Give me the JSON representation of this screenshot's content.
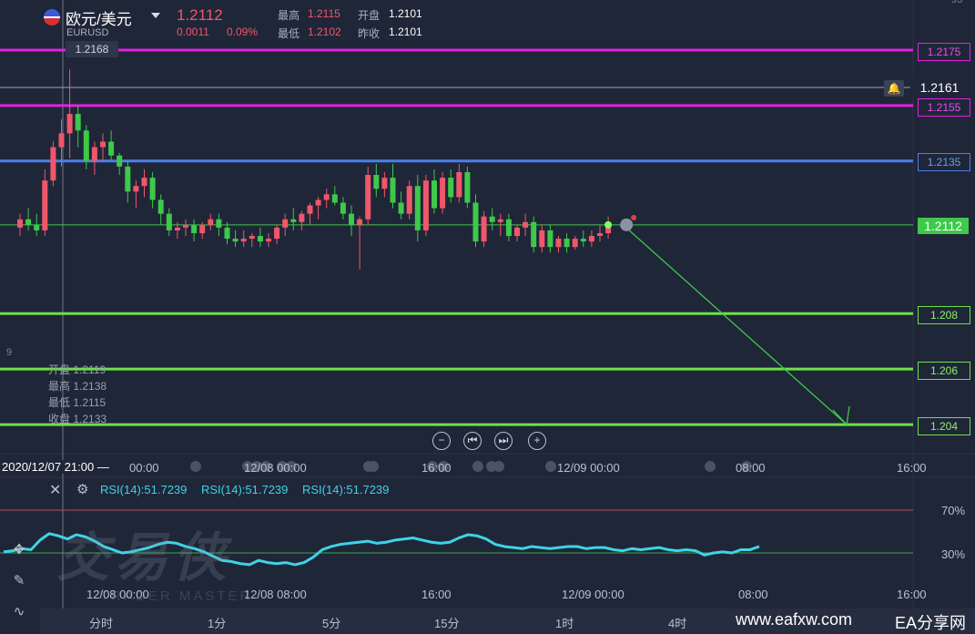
{
  "header": {
    "symbol": "欧元/美元",
    "sub_symbol": "EURUSD",
    "price": "1.2112",
    "change": "0.0011",
    "change_pct": "0.09%",
    "high_label": "最高",
    "high_value": "1.2115",
    "open_label": "开盘",
    "open_value": "1.2101",
    "low_label": "最低",
    "low_value": "1.2102",
    "prev_close_label": "昨收",
    "prev_close_value": "1.2101"
  },
  "crosshair": {
    "price_tag": "1.2168",
    "time_tag": "2020/12/07 21:00 —",
    "ohlc": [
      {
        "label": "开盘",
        "value": "1.2119"
      },
      {
        "label": "最高",
        "value": "1.2138"
      },
      {
        "label": "最低",
        "value": "1.2115"
      },
      {
        "label": "收盘",
        "value": "1.2133"
      }
    ],
    "side_digit": "9"
  },
  "price_levels": [
    {
      "value": "1.2175",
      "color": "#e020e0"
    },
    {
      "value": "1.2161",
      "color": "#a0a6b4"
    },
    {
      "value": "1.2155",
      "color": "#e020e0"
    },
    {
      "value": "1.2135",
      "color": "#4a7fe8"
    },
    {
      "value": "1.2112",
      "color": "#3ec94a"
    },
    {
      "value": "1.208",
      "color": "#6fe04a"
    },
    {
      "value": "1.206",
      "color": "#6fe04a"
    },
    {
      "value": "1.204",
      "color": "#6fe04a"
    }
  ],
  "top_right_partial": "93",
  "time_axis": [
    "00:00",
    "12/08 00:00",
    "16:00",
    "12/09 00:00",
    "08:00",
    "16:00"
  ],
  "rsi": {
    "labels": [
      "RSI(14):51.7239",
      "RSI(14):51.7239",
      "RSI(14):51.7239"
    ],
    "level_high": "70%",
    "level_low": "30%",
    "time_axis": [
      "12/08 00:00",
      "12/08 08:00",
      "16:00",
      "12/09 00:00",
      "08:00",
      "16:00"
    ]
  },
  "periods": [
    "分时",
    "1分",
    "5分",
    "15分",
    "1时",
    "4时"
  ],
  "watermark": {
    "cn": "交易侠",
    "en": "TRADER MASTER"
  },
  "footer": {
    "site": "www.eafxw.com",
    "brand": "EA分享网"
  },
  "colors": {
    "up": "#f0576a",
    "down": "#3ec94a",
    "rsi": "#3dd4e6",
    "bg": "#1f2638"
  },
  "chart_data": {
    "type": "candlestick",
    "candles": [
      [
        1.2111,
        1.2116,
        1.2108,
        1.2114
      ],
      [
        1.2114,
        1.2118,
        1.211,
        1.2112
      ],
      [
        1.2112,
        1.2116,
        1.2108,
        1.211
      ],
      [
        1.211,
        1.2132,
        1.2108,
        1.2128
      ],
      [
        1.2128,
        1.2142,
        1.2126,
        1.214
      ],
      [
        1.214,
        1.215,
        1.2133,
        1.2145
      ],
      [
        1.2145,
        1.2168,
        1.2136,
        1.2152
      ],
      [
        1.2152,
        1.2155,
        1.214,
        1.2146
      ],
      [
        1.2146,
        1.2148,
        1.2132,
        1.2135
      ],
      [
        1.2135,
        1.2142,
        1.213,
        1.214
      ],
      [
        1.214,
        1.2145,
        1.2135,
        1.2142
      ],
      [
        1.2142,
        1.2146,
        1.2135,
        1.2137
      ],
      [
        1.2137,
        1.2138,
        1.213,
        1.2133
      ],
      [
        1.2133,
        1.2135,
        1.212,
        1.2124
      ],
      [
        1.2124,
        1.2128,
        1.2118,
        1.2126
      ],
      [
        1.2126,
        1.2132,
        1.2122,
        1.2129
      ],
      [
        1.2129,
        1.2131,
        1.2118,
        1.2121
      ],
      [
        1.2121,
        1.2123,
        1.2112,
        1.2116
      ],
      [
        1.2116,
        1.2118,
        1.2108,
        1.211
      ],
      [
        1.211,
        1.2113,
        1.2107,
        1.2111
      ],
      [
        1.2111,
        1.2114,
        1.2108,
        1.2112
      ],
      [
        1.2112,
        1.2114,
        1.2106,
        1.2109
      ],
      [
        1.2109,
        1.2113,
        1.2107,
        1.2112
      ],
      [
        1.2112,
        1.2116,
        1.211,
        1.2114
      ],
      [
        1.2114,
        1.2116,
        1.2108,
        1.2111
      ],
      [
        1.2111,
        1.2113,
        1.2105,
        1.2107
      ],
      [
        1.2107,
        1.211,
        1.2104,
        1.2106
      ],
      [
        1.2106,
        1.211,
        1.2104,
        1.2107
      ],
      [
        1.2107,
        1.2109,
        1.2104,
        1.2108
      ],
      [
        1.2108,
        1.2111,
        1.2104,
        1.2106
      ],
      [
        1.2106,
        1.2109,
        1.2104,
        1.2107
      ],
      [
        1.2107,
        1.2112,
        1.2105,
        1.2111
      ],
      [
        1.2111,
        1.2116,
        1.2108,
        1.2114
      ],
      [
        1.2114,
        1.2118,
        1.211,
        1.2113
      ],
      [
        1.2113,
        1.2117,
        1.211,
        1.2116
      ],
      [
        1.2116,
        1.212,
        1.2112,
        1.2119
      ],
      [
        1.2119,
        1.2122,
        1.2114,
        1.2121
      ],
      [
        1.2121,
        1.2125,
        1.2118,
        1.2123
      ],
      [
        1.2123,
        1.2126,
        1.2119,
        1.212
      ],
      [
        1.212,
        1.2122,
        1.2114,
        1.2116
      ],
      [
        1.2116,
        1.2119,
        1.2108,
        1.2112
      ],
      [
        1.2112,
        1.2115,
        1.2096,
        1.2114
      ],
      [
        1.2114,
        1.2133,
        1.2112,
        1.213
      ],
      [
        1.213,
        1.2134,
        1.2122,
        1.2125
      ],
      [
        1.2125,
        1.2131,
        1.2122,
        1.2129
      ],
      [
        1.2129,
        1.2134,
        1.2118,
        1.212
      ],
      [
        1.212,
        1.2124,
        1.2114,
        1.2116
      ],
      [
        1.2116,
        1.2128,
        1.2114,
        1.2126
      ],
      [
        1.2126,
        1.213,
        1.2106,
        1.211
      ],
      [
        1.211,
        1.213,
        1.2108,
        1.2128
      ],
      [
        1.2128,
        1.2132,
        1.2116,
        1.2118
      ],
      [
        1.2118,
        1.2131,
        1.2116,
        1.2129
      ],
      [
        1.2129,
        1.2132,
        1.212,
        1.2122
      ],
      [
        1.2122,
        1.2134,
        1.212,
        1.2131
      ],
      [
        1.2131,
        1.2133,
        1.2118,
        1.212
      ],
      [
        1.212,
        1.2123,
        1.2104,
        1.2106
      ],
      [
        1.2106,
        1.2117,
        1.2104,
        1.2115
      ],
      [
        1.2115,
        1.2118,
        1.211,
        1.2113
      ],
      [
        1.2113,
        1.2116,
        1.2108,
        1.2114
      ],
      [
        1.2114,
        1.2116,
        1.2106,
        1.2108
      ],
      [
        1.2108,
        1.2112,
        1.2106,
        1.2111
      ],
      [
        1.2111,
        1.2116,
        1.2108,
        1.2113
      ],
      [
        1.2113,
        1.2115,
        1.2102,
        1.2104
      ],
      [
        1.2104,
        1.2112,
        1.2102,
        1.211
      ],
      [
        1.211,
        1.2112,
        1.2102,
        1.2104
      ],
      [
        1.2104,
        1.2108,
        1.2102,
        1.2107
      ],
      [
        1.2107,
        1.2109,
        1.2102,
        1.2104
      ],
      [
        1.2104,
        1.2108,
        1.2103,
        1.2107
      ],
      [
        1.2107,
        1.211,
        1.2104,
        1.2106
      ],
      [
        1.2106,
        1.211,
        1.2104,
        1.2108
      ],
      [
        1.2108,
        1.2112,
        1.2106,
        1.2109
      ],
      [
        1.2109,
        1.2115,
        1.2107,
        1.2112
      ]
    ],
    "forecast_target": 1.204,
    "rsi_values": [
      31,
      32,
      34,
      33,
      42,
      48,
      46,
      43,
      47,
      45,
      41,
      36,
      33,
      30,
      31,
      33,
      35,
      38,
      40,
      39,
      36,
      34,
      31,
      27,
      23,
      22,
      20,
      19,
      23,
      21,
      20,
      21,
      19,
      21,
      26,
      33,
      36,
      38,
      39,
      40,
      41,
      39,
      40,
      42,
      43,
      44,
      42,
      40,
      39,
      40,
      44,
      47,
      46,
      43,
      38,
      36,
      35,
      34,
      36,
      35,
      34,
      35,
      36,
      36,
      34,
      35,
      35,
      33,
      32,
      34,
      33,
      34,
      35,
      33,
      32,
      33,
      32,
      28,
      30,
      31,
      30,
      33,
      33,
      36
    ]
  }
}
